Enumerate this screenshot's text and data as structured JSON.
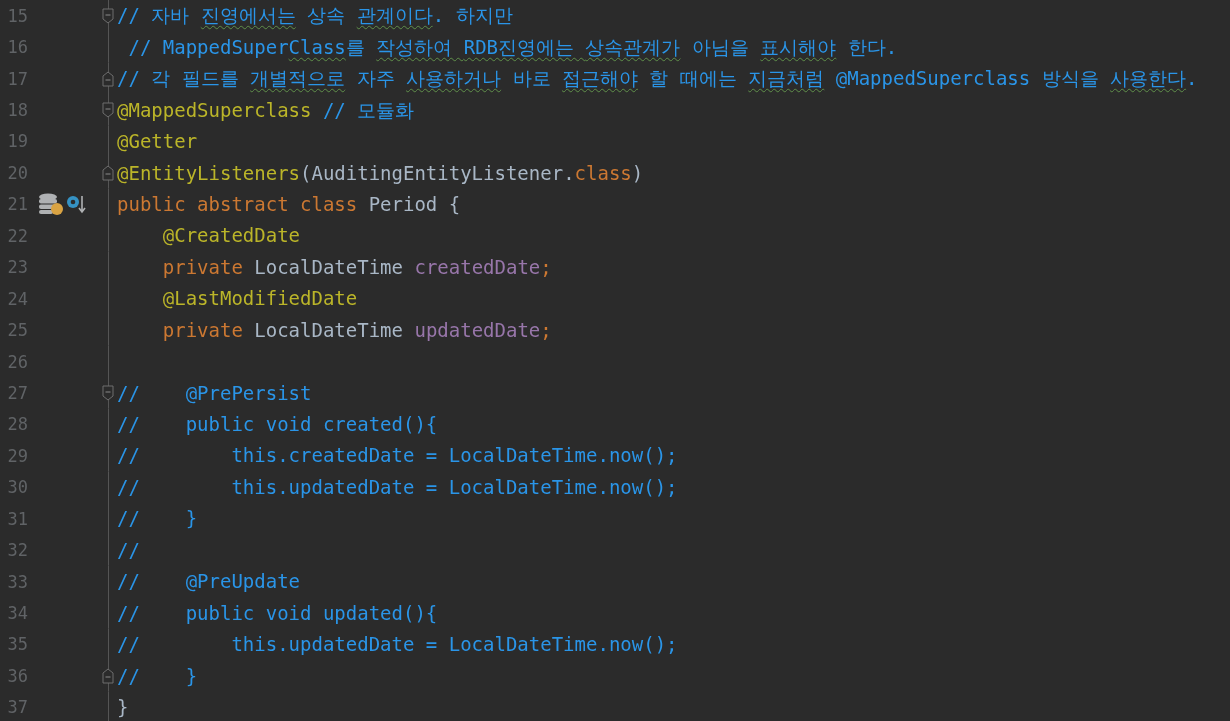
{
  "lines": [
    {
      "number": "15",
      "fold_marker": {
        "kind": "start"
      },
      "tokens": [
        {
          "text": "// 자바 ",
          "kind": "comment",
          "typo": false
        },
        {
          "text": "진영에서는",
          "kind": "comment",
          "typo": true
        },
        {
          "text": " 상속 ",
          "kind": "comment",
          "typo": false
        },
        {
          "text": "관계이다",
          "kind": "comment",
          "typo": true
        },
        {
          "text": ". 하지만",
          "kind": "comment",
          "typo": false
        }
      ]
    },
    {
      "number": "16",
      "tokens": [
        {
          "text": " // MappedSuper",
          "kind": "comment",
          "typo": false
        },
        {
          "text": "Class",
          "kind": "comment",
          "typo": true
        },
        {
          "text": "를 ",
          "kind": "comment",
          "typo": false
        },
        {
          "text": "작성하여 ",
          "kind": "comment",
          "typo": true
        },
        {
          "text": "RDB진영에는 ",
          "kind": "comment",
          "typo": true
        },
        {
          "text": "상속관계가",
          "kind": "comment",
          "typo": true
        },
        {
          "text": " 아님을 ",
          "kind": "comment",
          "typo": false
        },
        {
          "text": "표시해야",
          "kind": "comment",
          "typo": true
        },
        {
          "text": " 한다.",
          "kind": "comment",
          "typo": false
        }
      ]
    },
    {
      "number": "17",
      "fold_marker": {
        "kind": "end"
      },
      "tokens": [
        {
          "text": "// 각 필드를 ",
          "kind": "comment",
          "typo": false
        },
        {
          "text": "개별적으로",
          "kind": "comment",
          "typo": true
        },
        {
          "text": " 자주 ",
          "kind": "comment",
          "typo": false
        },
        {
          "text": "사용하거나",
          "kind": "comment",
          "typo": true
        },
        {
          "text": " 바로 ",
          "kind": "comment",
          "typo": false
        },
        {
          "text": "접근해야",
          "kind": "comment",
          "typo": true
        },
        {
          "text": " 할 때에는 ",
          "kind": "comment",
          "typo": false
        },
        {
          "text": "지금처럼",
          "kind": "comment",
          "typo": true
        },
        {
          "text": " @MappedSuperclass 방식을 ",
          "kind": "comment",
          "typo": false
        },
        {
          "text": "사용한다",
          "kind": "comment",
          "typo": true
        },
        {
          "text": ".",
          "kind": "comment",
          "typo": false
        }
      ]
    },
    {
      "number": "18",
      "fold_marker": {
        "kind": "start"
      },
      "tokens": [
        {
          "text": "@MappedSuperclass",
          "kind": "annotation",
          "typo": false
        },
        {
          "text": " // 모듈화",
          "kind": "comment",
          "typo": false
        }
      ]
    },
    {
      "number": "19",
      "tokens": [
        {
          "text": "@Getter",
          "kind": "annotation",
          "typo": false
        }
      ]
    },
    {
      "number": "20",
      "fold_marker": {
        "kind": "end"
      },
      "tokens": [
        {
          "text": "@EntityListeners",
          "kind": "annotation",
          "typo": false
        },
        {
          "text": "(AuditingEntityListener.",
          "kind": "plain",
          "typo": false
        },
        {
          "text": "class",
          "kind": "keyword",
          "typo": false
        },
        {
          "text": ")",
          "kind": "plain",
          "typo": false
        }
      ]
    },
    {
      "number": "21",
      "gutter_icons": [
        {
          "kind": "database"
        },
        {
          "kind": "implemented"
        }
      ],
      "tokens": [
        {
          "text": "public abstract class ",
          "kind": "keyword",
          "typo": false
        },
        {
          "text": "Period {",
          "kind": "plain",
          "typo": false
        }
      ]
    },
    {
      "number": "22",
      "tokens": [
        {
          "text": "    @CreatedDate",
          "kind": "annotation",
          "typo": false
        }
      ]
    },
    {
      "number": "23",
      "tokens": [
        {
          "text": "    private ",
          "kind": "keyword",
          "typo": false
        },
        {
          "text": "LocalDateTime ",
          "kind": "plain",
          "typo": false
        },
        {
          "text": "createdDate",
          "kind": "field",
          "typo": false
        },
        {
          "text": ";",
          "kind": "keyword",
          "typo": false
        }
      ]
    },
    {
      "number": "24",
      "tokens": [
        {
          "text": "    @LastModifiedDate",
          "kind": "annotation",
          "typo": false
        }
      ]
    },
    {
      "number": "25",
      "tokens": [
        {
          "text": "    private ",
          "kind": "keyword",
          "typo": false
        },
        {
          "text": "LocalDateTime ",
          "kind": "plain",
          "typo": false
        },
        {
          "text": "updatedDate",
          "kind": "field",
          "typo": false
        },
        {
          "text": ";",
          "kind": "keyword",
          "typo": false
        }
      ]
    },
    {
      "number": "26"
    },
    {
      "number": "27",
      "fold_marker": {
        "kind": "start"
      },
      "tokens": [
        {
          "text": "//    @PrePersist",
          "kind": "comment",
          "typo": false
        }
      ]
    },
    {
      "number": "28",
      "tokens": [
        {
          "text": "//    public void created(){",
          "kind": "comment",
          "typo": false
        }
      ]
    },
    {
      "number": "29",
      "tokens": [
        {
          "text": "//        this.createdDate = LocalDateTime.now();",
          "kind": "comment",
          "typo": false
        }
      ]
    },
    {
      "number": "30",
      "tokens": [
        {
          "text": "//        this.updatedDate = LocalDateTime.now();",
          "kind": "comment",
          "typo": false
        }
      ]
    },
    {
      "number": "31",
      "tokens": [
        {
          "text": "//    }",
          "kind": "comment",
          "typo": false
        }
      ]
    },
    {
      "number": "32",
      "tokens": [
        {
          "text": "//",
          "kind": "comment",
          "typo": false
        }
      ]
    },
    {
      "number": "33",
      "tokens": [
        {
          "text": "//    @PreUpdate",
          "kind": "comment",
          "typo": false
        }
      ]
    },
    {
      "number": "34",
      "tokens": [
        {
          "text": "//    public void updated(){",
          "kind": "comment",
          "typo": false
        }
      ]
    },
    {
      "number": "35",
      "tokens": [
        {
          "text": "//        this.updatedDate = LocalDateTime.now();",
          "kind": "comment",
          "typo": false
        }
      ]
    },
    {
      "number": "36",
      "fold_marker": {
        "kind": "end"
      },
      "tokens": [
        {
          "text": "//    }",
          "kind": "comment",
          "typo": false
        }
      ]
    },
    {
      "number": "37",
      "tokens": [
        {
          "text": "}",
          "kind": "plain",
          "typo": false
        }
      ]
    }
  ]
}
